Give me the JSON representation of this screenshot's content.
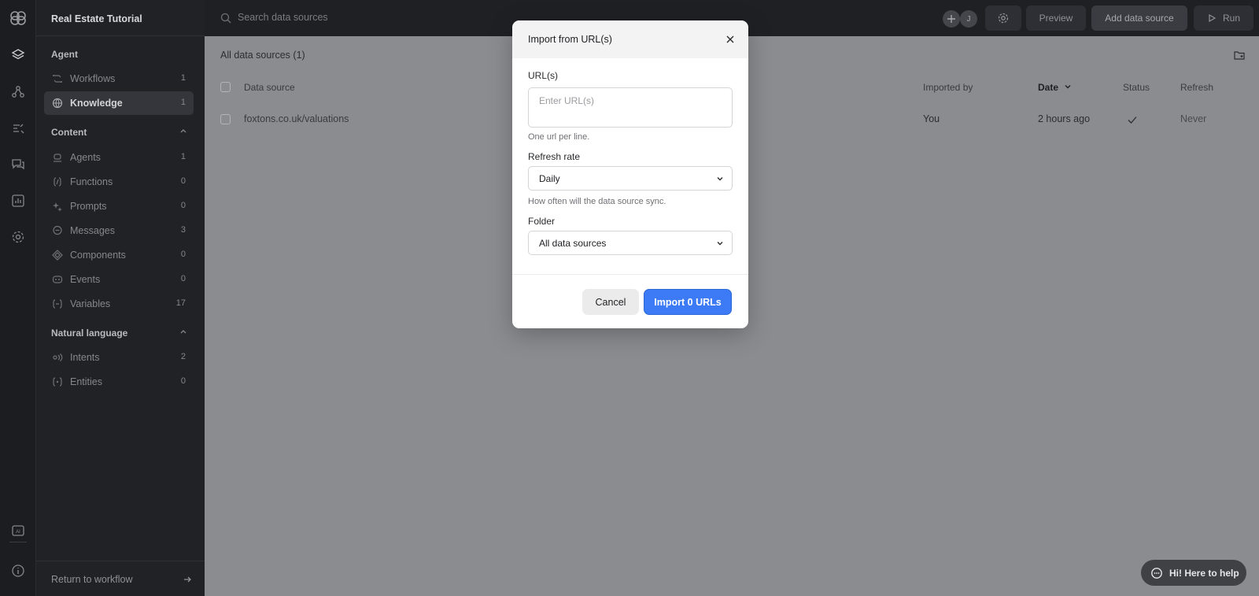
{
  "app": {
    "project_name": "Real Estate Tutorial"
  },
  "sidebar": {
    "sections": [
      {
        "title": "Agent"
      },
      {
        "title": "Content"
      },
      {
        "title": "Natural language"
      }
    ],
    "items": [
      {
        "label": "Workflows",
        "count": "1"
      },
      {
        "label": "Knowledge",
        "count": "1"
      },
      {
        "label": "Agents",
        "count": "1"
      },
      {
        "label": "Functions",
        "count": "0"
      },
      {
        "label": "Prompts",
        "count": "0"
      },
      {
        "label": "Messages",
        "count": "3"
      },
      {
        "label": "Components",
        "count": "0"
      },
      {
        "label": "Events",
        "count": "0"
      },
      {
        "label": "Variables",
        "count": "17"
      },
      {
        "label": "Intents",
        "count": "2"
      },
      {
        "label": "Entities",
        "count": "0"
      }
    ],
    "return_label": "Return to workflow"
  },
  "topbar": {
    "search_placeholder": "Search data sources",
    "avatar_initial": "J",
    "preview_label": "Preview",
    "add_source_label": "Add data source",
    "run_label": "Run"
  },
  "content": {
    "title": "All data sources (1)",
    "columns": [
      "Data source",
      "Imported by",
      "Date",
      "Status",
      "Refresh"
    ],
    "rows": [
      {
        "source": "foxtons.co.uk/valuations",
        "imported_by": "You",
        "date": "2 hours ago",
        "status": "check",
        "refresh": "Never"
      }
    ]
  },
  "modal": {
    "title": "Import from URL(s)",
    "urls_label": "URL(s)",
    "urls_placeholder": "Enter URL(s)",
    "urls_help": "One url per line.",
    "refresh_label": "Refresh rate",
    "refresh_value": "Daily",
    "refresh_help": "How often will the data source sync.",
    "folder_label": "Folder",
    "folder_value": "All data sources",
    "cancel_label": "Cancel",
    "import_label": "Import 0 URLs"
  },
  "help_widget": {
    "label": "Hi! Here to help"
  },
  "colors": {
    "primary": "#3c7bf5",
    "sidebar_bg": "#202226",
    "overlay_bg": "#8b8c8f"
  }
}
